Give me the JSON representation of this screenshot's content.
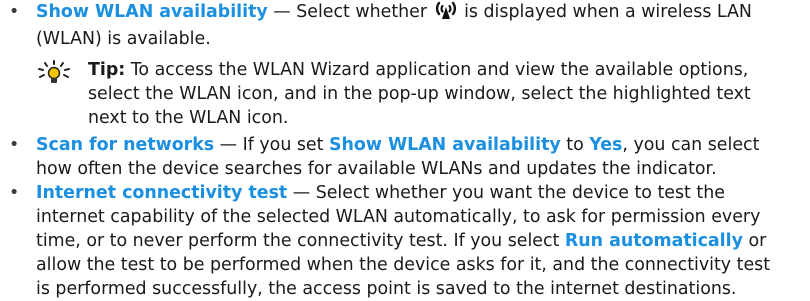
{
  "bullet_char": "•",
  "items": [
    {
      "term": "Show WLAN availability",
      "lines": [
        {
          "before": " — Select whether ",
          "icon": "wlan-antenna-icon",
          "after": " is displayed when a wireless LAN"
        },
        "(WLAN) is available."
      ]
    },
    {
      "term": "Scan for networks",
      "lines": [
        {
          "pre": " — If you set ",
          "em1": "Show WLAN availability",
          "mid": " to ",
          "em2": "Yes",
          "post": ", you can select"
        },
        "how often the device searches for available WLANs and updates the indicator."
      ]
    },
    {
      "term": "Internet connectivity test",
      "lines": [
        " — Select whether you want the device to test the",
        "internet capability of the selected WLAN automatically, to ask for permission every",
        "time, or to never perform the connectivity test. If you select ",
        "allow the test to be performed when the device asks for it, and the connectivity test",
        "is performed successfully, the access point is saved to the internet destinations."
      ],
      "inline_term": "Run automatically",
      "inline_after": " or"
    }
  ],
  "tip": {
    "icon": "lightbulb-tip-icon",
    "label": "Tip:",
    "lines": [
      " To access the WLAN Wizard application and view the available options,",
      "select the WLAN icon, and in the pop-up window, select the highlighted text",
      "next to the WLAN icon."
    ]
  }
}
